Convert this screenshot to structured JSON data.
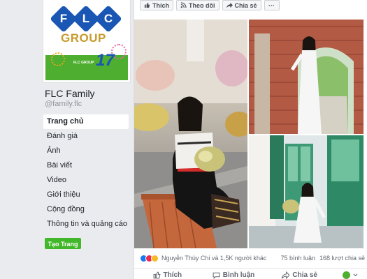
{
  "page": {
    "name": "FLC Family",
    "handle": "@family.flc"
  },
  "logo": {
    "letters": [
      "F",
      "L",
      "C"
    ],
    "group": "GROUP",
    "small_text": "FLC GROUP",
    "anniversary": "17"
  },
  "nav": {
    "items": [
      {
        "label": "Trang chủ",
        "active": true
      },
      {
        "label": "Đánh giá"
      },
      {
        "label": "Ảnh"
      },
      {
        "label": "Bài viết"
      },
      {
        "label": "Video"
      },
      {
        "label": "Giới thiệu"
      },
      {
        "label": "Cộng đồng"
      },
      {
        "label": "Thông tin và quảng cáo"
      }
    ],
    "create_button": "Tạo Trang"
  },
  "post": {
    "top_actions": {
      "like": "Thích",
      "follow": "Theo dõi",
      "share": "Chia sẻ",
      "more": "···"
    },
    "reactions_text": "Nguyễn Thùy Chi và 1,5K người khác",
    "comments_count": "75 bình luận",
    "shares_count": "168 lượt chia sẻ",
    "actions": {
      "like": "Thích",
      "comment": "Bình luận",
      "share": "Chia sẻ"
    }
  },
  "colors": {
    "brand_blue": "#1a56b4",
    "brand_gold": "#c79b2c",
    "brand_green": "#4dae2f",
    "create_button": "#42b72a"
  }
}
